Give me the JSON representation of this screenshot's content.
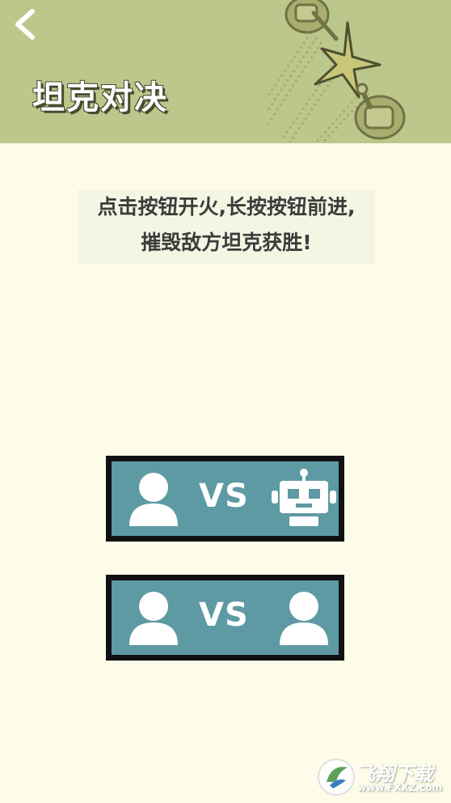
{
  "header": {
    "back_icon": "chevron-left-icon",
    "title": "坦克对决",
    "background_color": "#bcc78b"
  },
  "instructions": {
    "line1": "点击按钮开火,长按按钮前进,",
    "line2": "摧毁敌方坦克获胜!"
  },
  "modes": [
    {
      "left_icon": "user-icon",
      "vs_label": "VS",
      "right_icon": "robot-icon"
    },
    {
      "left_icon": "user-icon",
      "vs_label": "VS",
      "right_icon": "user-icon"
    }
  ],
  "watermark": {
    "name": "飞翔下载",
    "url": "www.FXXZ.com"
  },
  "colors": {
    "page_background": "#fcfce9",
    "button_fill": "#5e9aa3",
    "button_border": "#111111"
  }
}
